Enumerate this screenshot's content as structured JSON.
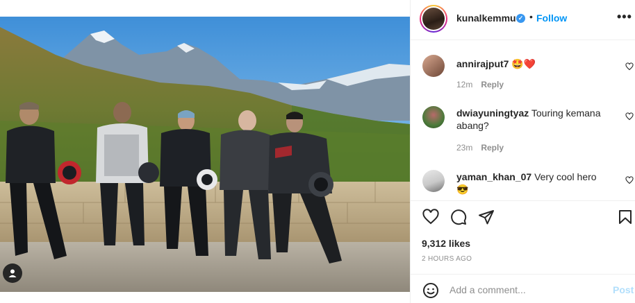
{
  "post": {
    "username": "kunalkemmu",
    "verified_mark": "✓",
    "separator": "•",
    "follow_label": "Follow",
    "more_label": "•••",
    "image_alt": "Group of riders posing with helmets in front of mountains"
  },
  "comments": [
    {
      "username": "annirajput7",
      "text": "🤩❤️",
      "time": "12m",
      "reply_label": "Reply"
    },
    {
      "username": "dwiayuningtyaz",
      "text": "Touring kemana abang?",
      "time": "23m",
      "reply_label": "Reply"
    },
    {
      "username": "yaman_khan_07",
      "text": "Very cool hero 😎",
      "time": "",
      "reply_label": ""
    }
  ],
  "stats": {
    "likes": "9,312 likes",
    "posted": "2 HOURS AGO"
  },
  "add_comment": {
    "placeholder": "Add a comment...",
    "post_label": "Post"
  },
  "colors": {
    "accent": "#0095f6",
    "verified": "#3897f0",
    "muted": "#8e8e8e",
    "post_disabled": "#b2dffc"
  },
  "icons": {
    "tag": "person-tag-icon",
    "like": "heart-icon",
    "comment": "speech-bubble-icon",
    "share": "paper-plane-icon",
    "save": "bookmark-icon",
    "emoji": "smiley-icon"
  }
}
